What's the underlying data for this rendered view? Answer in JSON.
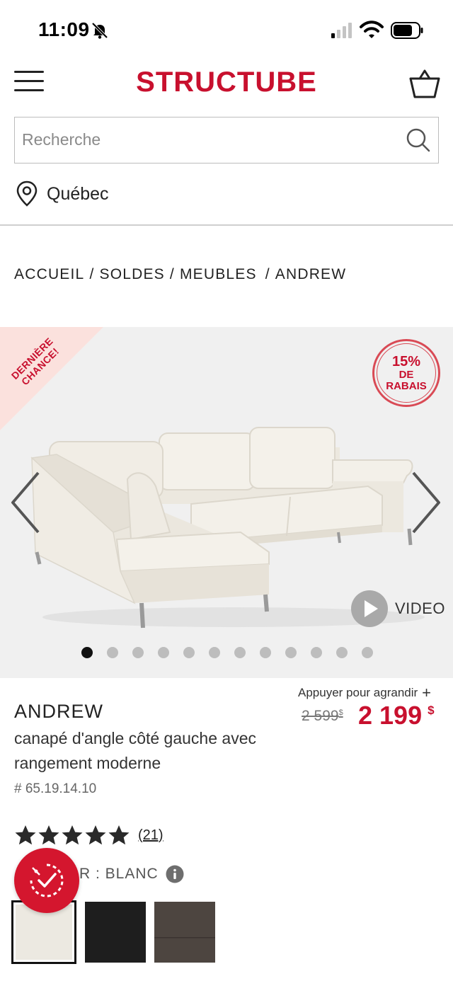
{
  "status_bar": {
    "time": "11:09"
  },
  "header": {
    "logo": "STRUCTUBE"
  },
  "search": {
    "placeholder": "Recherche"
  },
  "location": {
    "label": "Québec"
  },
  "breadcrumb": {
    "items": [
      "ACCUEIL",
      "SOLDES",
      "MEUBLES",
      "ANDREW"
    ],
    "separator": "/"
  },
  "gallery": {
    "ribbon_line1": "DERNIÈRE",
    "ribbon_line2": "CHANCE!",
    "badge_percent": "15%",
    "badge_line2": "DE",
    "badge_line3": "RABAIS",
    "video_label": "VIDEO",
    "dot_count": 12,
    "active_dot": 0
  },
  "product": {
    "zoom_hint": "Appuyer pour agrandir",
    "zoom_plus": "+",
    "old_price": "2 599",
    "old_price_currency": "$",
    "new_price": "2 199",
    "new_price_currency": "$",
    "name": "ANDREW",
    "description": "canapé d'angle côté gauche avec rangement moderne",
    "sku": "# 65.19.14.10",
    "rating_stars": 5,
    "review_count": "(21)",
    "color_label": "R : BLANC"
  },
  "swatches": [
    {
      "name": "blanc",
      "color": "#ece9e1",
      "selected": true
    },
    {
      "name": "noir",
      "color": "#1e1e1e",
      "selected": false
    },
    {
      "name": "brun",
      "color": "#4d4540",
      "selected": false
    }
  ],
  "colors": {
    "brand": "#c8102e",
    "accent": "#d4162e"
  }
}
